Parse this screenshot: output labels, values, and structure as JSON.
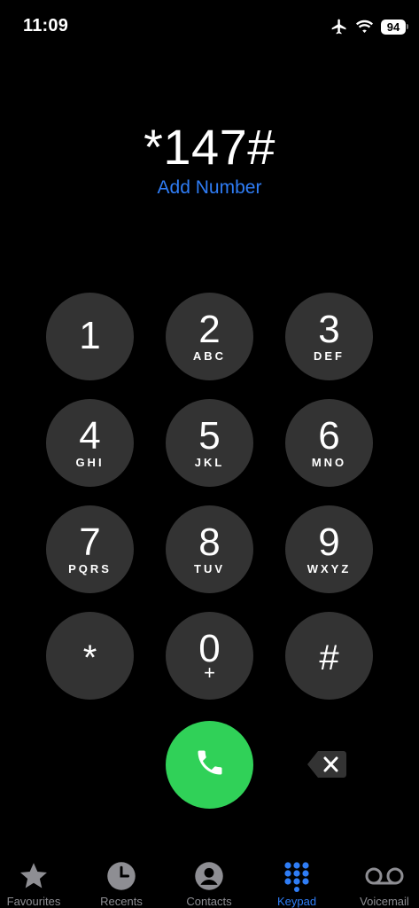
{
  "status_bar": {
    "time": "11:09",
    "battery": "94",
    "icons": [
      "airplane-icon",
      "wifi-icon",
      "battery-icon"
    ]
  },
  "dialer": {
    "number": "*147#",
    "add_number_label": "Add Number"
  },
  "keypad": {
    "keys": [
      {
        "digit": "1",
        "letters": ""
      },
      {
        "digit": "2",
        "letters": "ABC"
      },
      {
        "digit": "3",
        "letters": "DEF"
      },
      {
        "digit": "4",
        "letters": "GHI"
      },
      {
        "digit": "5",
        "letters": "JKL"
      },
      {
        "digit": "6",
        "letters": "MNO"
      },
      {
        "digit": "7",
        "letters": "PQRS"
      },
      {
        "digit": "8",
        "letters": "TUV"
      },
      {
        "digit": "9",
        "letters": "WXYZ"
      },
      {
        "digit": "*",
        "letters": ""
      },
      {
        "digit": "0",
        "letters": "+"
      },
      {
        "digit": "#",
        "letters": ""
      }
    ],
    "call_icon": "phone-icon",
    "delete_icon": "backspace-icon"
  },
  "tab_bar": {
    "tabs": [
      {
        "label": "Favourites",
        "icon": "star-icon",
        "active": false
      },
      {
        "label": "Recents",
        "icon": "clock-icon",
        "active": false
      },
      {
        "label": "Contacts",
        "icon": "person-circle-icon",
        "active": false
      },
      {
        "label": "Keypad",
        "icon": "keypad-icon",
        "active": true
      },
      {
        "label": "Voicemail",
        "icon": "voicemail-icon",
        "active": false
      }
    ]
  },
  "colors": {
    "background": "#000000",
    "key": "#333333",
    "call": "#30d158",
    "accent": "#2f7df6",
    "inactive_tab": "#8e8e93"
  }
}
